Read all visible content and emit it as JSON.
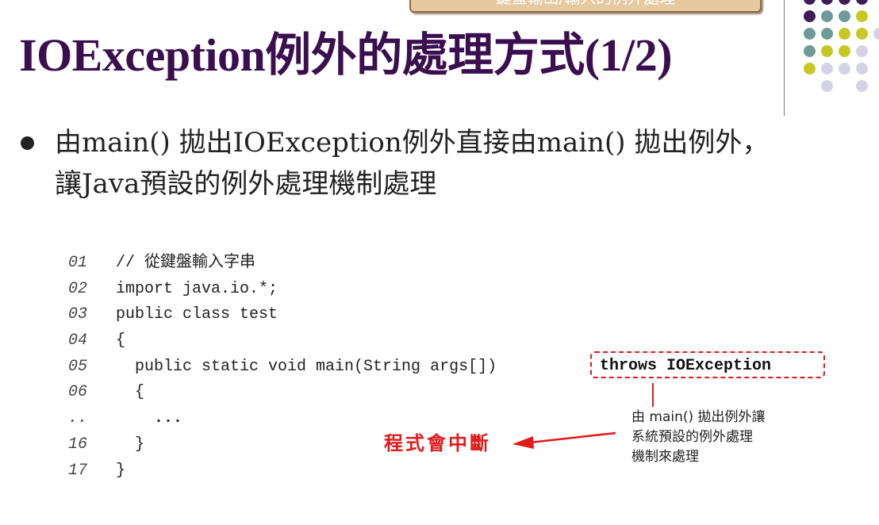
{
  "header_tab": {
    "text": "鍵盤輸出/輸入的例外處理"
  },
  "title": "IOException例外的處理方式(1/2)",
  "bullet": {
    "line1": "由main() 拋出IOException例外直接由main() 拋出例外，",
    "line2": "讓Java預設的例外處理機制處理"
  },
  "code": [
    {
      "ln": "01",
      "text": "// 從鍵盤輸入字串"
    },
    {
      "ln": "02",
      "text": "import java.io.*;"
    },
    {
      "ln": "03",
      "text": "public class test"
    },
    {
      "ln": "04",
      "text": "{"
    },
    {
      "ln": "05",
      "text": "  public static void main(String args[])"
    },
    {
      "ln": "06",
      "text": "  {"
    },
    {
      "ln": "..",
      "text": "    ..."
    },
    {
      "ln": "16",
      "text": "  }"
    },
    {
      "ln": "17",
      "text": "}"
    }
  ],
  "throws_clause": "throws IOException",
  "explanation": {
    "line1": "由 main() 拋出例外讓",
    "line2": "系統預設的例外處理",
    "line3": "機制來處理"
  },
  "crash_note": "程式會中斷",
  "colors": {
    "title": "#3b0f4f",
    "highlight": "#e21b1b",
    "dot_purple": "#3f1a5a",
    "dot_teal": "#6e9b9a",
    "dot_olive": "#c8c825",
    "dot_lavender": "#d4d3e6"
  }
}
